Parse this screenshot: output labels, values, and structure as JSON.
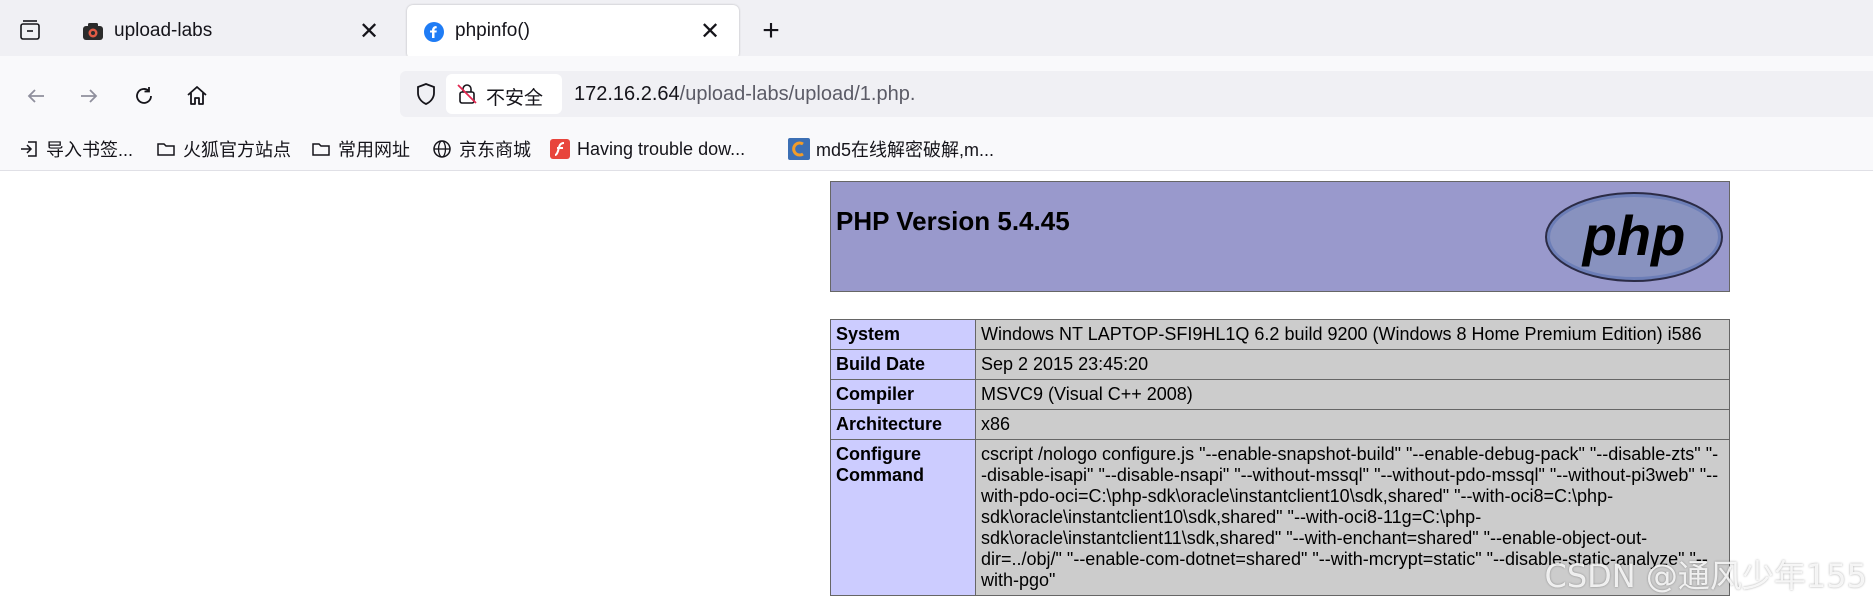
{
  "tabs": [
    {
      "title": "upload-labs",
      "icon": "camera-favicon-icon",
      "active": false
    },
    {
      "title": "phpinfo()",
      "icon": "firefox-favicon-icon",
      "active": true
    }
  ],
  "navbar": {
    "security_label": "不安全",
    "url_host": "172.16.2.64",
    "url_path": "/upload-labs/upload/1.php."
  },
  "bookmarks": [
    {
      "label": "导入书签...",
      "icon": "import-icon"
    },
    {
      "label": "火狐官方站点",
      "icon": "folder-icon"
    },
    {
      "label": "常用网址",
      "icon": "folder-icon"
    },
    {
      "label": "京东商城",
      "icon": "globe-icon"
    },
    {
      "label": "Having trouble dow...",
      "icon": "flash-icon"
    },
    {
      "label": "md5在线解密破解,m...",
      "icon": "cmd5-icon"
    }
  ],
  "page": {
    "version_title": "PHP Version 5.4.45",
    "logo_text": "php",
    "rows": [
      {
        "key": "System",
        "value": "Windows NT LAPTOP-SFI9HL1Q 6.2 build 9200 (Windows 8 Home Premium Edition) i586"
      },
      {
        "key": "Build Date",
        "value": "Sep 2 2015 23:45:20"
      },
      {
        "key": "Compiler",
        "value": "MSVC9 (Visual C++ 2008)"
      },
      {
        "key": "Architecture",
        "value": "x86"
      },
      {
        "key": "Configure Command",
        "value": "cscript /nologo configure.js \"--enable-snapshot-build\" \"--enable-debug-pack\" \"--disable-zts\" \"--disable-isapi\" \"--disable-nsapi\" \"--without-mssql\" \"--without-pdo-mssql\" \"--without-pi3web\" \"--with-pdo-oci=C:\\php-sdk\\oracle\\instantclient10\\sdk,shared\" \"--with-oci8=C:\\php-sdk\\oracle\\instantclient10\\sdk,shared\" \"--with-oci8-11g=C:\\php-sdk\\oracle\\instantclient11\\sdk,shared\" \"--with-enchant=shared\" \"--enable-object-out-dir=../obj/\" \"--enable-com-dotnet=shared\" \"--with-mcrypt=static\" \"--disable-static-analyze\" \"--with-pgo\""
      }
    ]
  },
  "watermark": "CSDN @通风少年155"
}
